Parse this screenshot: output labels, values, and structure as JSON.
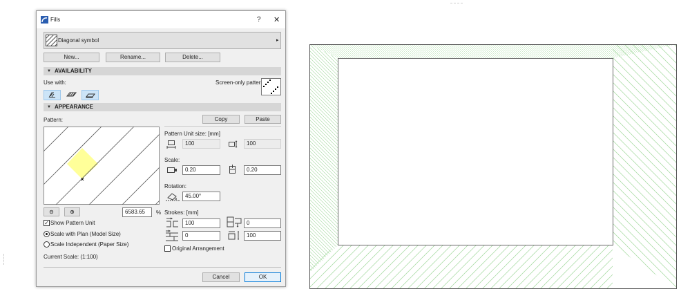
{
  "dialog": {
    "title": "Fills",
    "help_label": "?",
    "close_label": "✕",
    "fill_name": "Diagonal symbol",
    "buttons": {
      "new": "New...",
      "rename": "Rename...",
      "delete": "Delete...",
      "copy": "Copy",
      "paste": "Paste",
      "cancel": "Cancel",
      "ok": "OK"
    },
    "availability": {
      "header": "AVAILABILITY",
      "use_with_label": "Use with:",
      "screen_only_label": "Screen-only pattern:",
      "use_with_toggles": [
        {
          "icon": "cut-fill-icon",
          "active": true
        },
        {
          "icon": "cover-fill-icon",
          "active": false
        },
        {
          "icon": "drafting-fill-icon",
          "active": true
        }
      ]
    },
    "appearance": {
      "header": "APPEARANCE",
      "pattern_label": "Pattern:",
      "zoom_percent": "6583.65",
      "percent_sign": "%",
      "show_pattern_unit": {
        "label": "Show Pattern Unit",
        "checked": true
      },
      "scale_options": [
        {
          "label": "Scale with Plan (Model Size)",
          "selected": true
        },
        {
          "label": "Scale Independent (Paper Size)",
          "selected": false
        }
      ],
      "current_scale": "Current Scale: (1:100)",
      "pattern_unit_size_label": "Pattern Unit size: [mm]",
      "unit_width": "100",
      "unit_height": "100",
      "scale_label": "Scale:",
      "scale_x": "0.20",
      "scale_y": "0.20",
      "rotation_label": "Rotation:",
      "rotation": "45.00°",
      "strokes_label": "Strokes: [mm]",
      "stroke_1": "100",
      "stroke_2": "0",
      "stroke_3": "0",
      "stroke_4": "100",
      "original_arrangement": {
        "label": "Original Arrangement",
        "checked": false
      }
    }
  },
  "colors": {
    "hatch": "#9fd89a",
    "accent": "#0078d7",
    "unit_highlight": "#ffff99"
  }
}
